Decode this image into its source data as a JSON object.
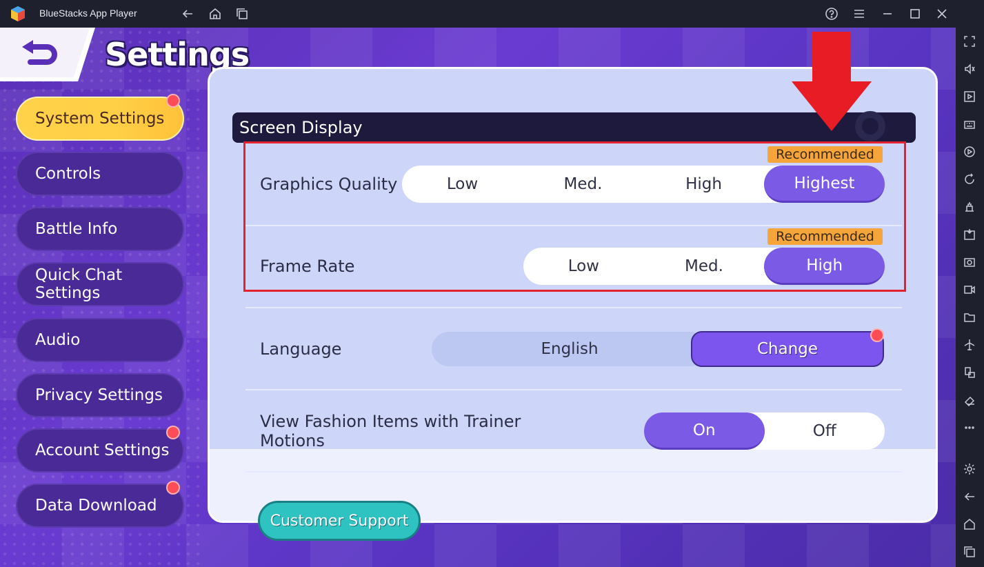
{
  "window": {
    "title": "BlueStacks App Player"
  },
  "header": {
    "title": "Settings"
  },
  "nav": {
    "items": [
      {
        "label": "System Settings",
        "active": true,
        "badge": true
      },
      {
        "label": "Controls",
        "active": false,
        "badge": false
      },
      {
        "label": "Battle Info",
        "active": false,
        "badge": false
      },
      {
        "label": "Quick Chat\nSettings",
        "active": false,
        "badge": false
      },
      {
        "label": "Audio",
        "active": false,
        "badge": false
      },
      {
        "label": "Privacy Settings",
        "active": false,
        "badge": false
      },
      {
        "label": "Account Settings",
        "active": false,
        "badge": true
      },
      {
        "label": "Data Download",
        "active": false,
        "badge": true
      }
    ]
  },
  "panel": {
    "section_title": "Screen Display",
    "graphics_quality": {
      "label": "Graphics Quality",
      "options": [
        "Low",
        "Med.",
        "High",
        "Highest"
      ],
      "selected": "Highest",
      "tag": "Recommended"
    },
    "frame_rate": {
      "label": "Frame Rate",
      "options": [
        "Low",
        "Med.",
        "High"
      ],
      "selected": "High",
      "tag": "Recommended"
    },
    "language": {
      "label": "Language",
      "value": "English",
      "change_label": "Change"
    },
    "fashion": {
      "label": "View Fashion Items with Trainer\nMotions",
      "options": [
        "On",
        "Off"
      ],
      "selected": "On"
    },
    "support_label": "Customer Support"
  },
  "colors": {
    "accent": "#7b5ae6",
    "nav_active": "#ffd24a",
    "highlight": "#e3222e",
    "recommended": "#f6a53a",
    "support": "#2ec3c0"
  },
  "icons": {
    "titlebar": [
      "back-arrow-icon",
      "home-icon",
      "multi-instance-icon",
      "help-icon",
      "menu-icon",
      "minimize-icon",
      "maximize-icon",
      "close-icon"
    ],
    "toolbar": [
      "fullscreen-icon",
      "volume-icon",
      "media-icon",
      "keyboard-icon",
      "play-icon",
      "rotate-icon",
      "build-icon",
      "apk-icon",
      "screenshot-icon",
      "record-icon",
      "folder-icon",
      "airplane-icon",
      "resize-icon",
      "eraser-icon",
      "more-icon",
      "settings-icon",
      "back-icon",
      "home-icon",
      "recent-apps-icon"
    ]
  }
}
